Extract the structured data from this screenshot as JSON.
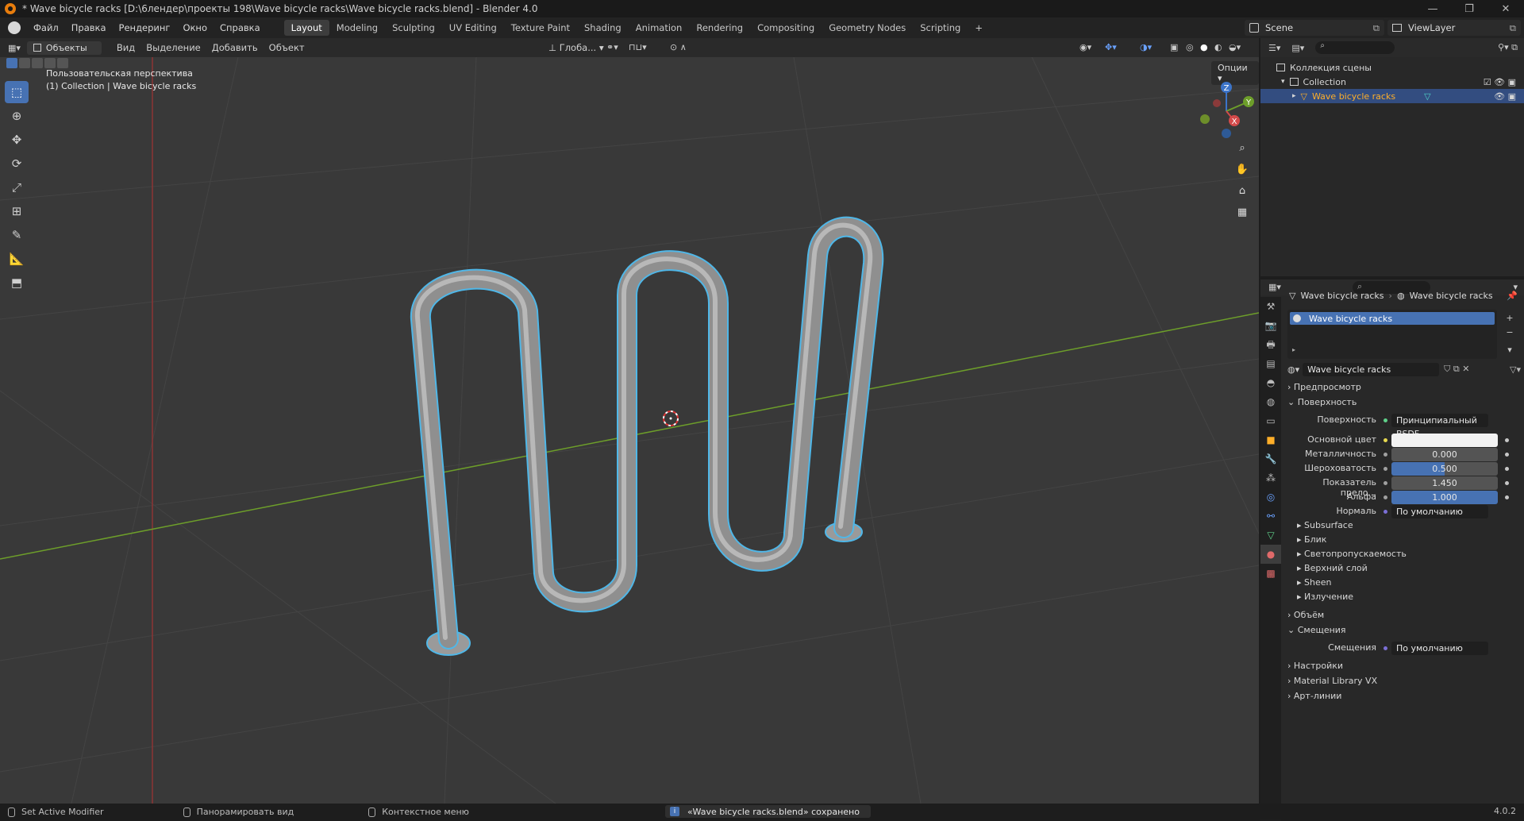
{
  "window": {
    "title": "* Wave bicycle racks [D:\\6лендер\\проекты 198\\Wave bicycle racks\\Wave bicycle racks.blend] - Blender 4.0",
    "minimize": "—",
    "maximize": "❐",
    "close": "✕"
  },
  "menu": [
    "Файл",
    "Правка",
    "Рендеринг",
    "Окно",
    "Справка"
  ],
  "workspaces": [
    "Layout",
    "Modeling",
    "Sculpting",
    "UV Editing",
    "Texture Paint",
    "Shading",
    "Animation",
    "Rendering",
    "Compositing",
    "Geometry Nodes",
    "Scripting"
  ],
  "workspace_add": "+",
  "scene": "Scene",
  "view_layer": "ViewLayer",
  "viewport": {
    "mode": "Объекты",
    "menus": [
      "Вид",
      "Выделение",
      "Добавить",
      "Объект"
    ],
    "transform_orientation": "Глоба...",
    "options": "Опции",
    "overlay_line1": "Пользовательская перспектива",
    "overlay_line2": "(1) Collection | Wave bicycle racks",
    "gizmo": {
      "z": "Z",
      "y": "Y",
      "x": "X"
    }
  },
  "outliner": {
    "scene_collection": "Коллекция сцены",
    "collection": "Collection",
    "object": "Wave bicycle racks"
  },
  "properties": {
    "breadcrumb_object": "Wave bicycle racks",
    "breadcrumb_material": "Wave bicycle racks",
    "slot": "Wave bicycle racks",
    "material_name": "Wave bicycle racks",
    "sections": {
      "preview": "Предпросмотр",
      "surface": "Поверхность",
      "volume": "Объём",
      "displacement": "Смещения",
      "settings": "Настройки",
      "material_library": "Material Library VX",
      "lineart": "Арт-линии"
    },
    "surface_label": "Поверхность",
    "surface_value": "Принципиальный BSDF",
    "fields": [
      {
        "label": "Основной цвет",
        "value": ""
      },
      {
        "label": "Металличность",
        "value": "0.000"
      },
      {
        "label": "Шероховатость",
        "value": "0.500"
      },
      {
        "label": "Показатель прело...",
        "value": "1.450"
      },
      {
        "label": "Альфа",
        "value": "1.000"
      },
      {
        "label": "Нормаль",
        "value": "По умолчанию"
      }
    ],
    "subpanels": [
      "Subsurface",
      "Блик",
      "Светопропускаемость",
      "Верхний слой",
      "Sheen",
      "Излучение"
    ],
    "displacement_label": "Смещения",
    "displacement_value": "По умолчанию"
  },
  "status": {
    "left": "Set Active Modifier",
    "middle": "Панорамировать вид",
    "right": "Контекстное меню",
    "message": "«Wave bicycle racks.blend» сохранено",
    "version": "4.0.2"
  },
  "colors": {
    "accent": "#4772b3",
    "selection_outline": "#4fb7e8",
    "x_axis": "#b53a3a",
    "y_axis": "#6d9e2a",
    "active_object": "#ffaf29"
  }
}
